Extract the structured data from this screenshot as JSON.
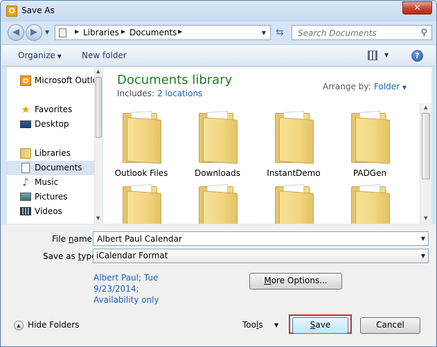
{
  "window": {
    "title": "Save As",
    "close_symbol": "✕"
  },
  "nav": {
    "breadcrumbs": [
      "Libraries",
      "Documents"
    ],
    "search_placeholder": "Search Documents"
  },
  "toolbar": {
    "organize": "Organize",
    "new_folder": "New folder"
  },
  "sidebar": {
    "items": [
      {
        "label": "Microsoft Outlo",
        "icon": "outlook-icon"
      },
      {
        "label": "Favorites",
        "icon": "star-icon"
      },
      {
        "label": "Desktop",
        "icon": "desktop-icon"
      },
      {
        "label": "Libraries",
        "icon": "library-icon"
      },
      {
        "label": "Documents",
        "icon": "document-icon",
        "selected": true
      },
      {
        "label": "Music",
        "icon": "music-icon"
      },
      {
        "label": "Pictures",
        "icon": "pictures-icon"
      },
      {
        "label": "Videos",
        "icon": "videos-icon"
      }
    ]
  },
  "library": {
    "title": "Documents library",
    "includes_label": "Includes:",
    "locations_link": "2 locations",
    "arrange_label": "Arrange by:",
    "arrange_value": "Folder"
  },
  "folders": [
    {
      "label": "Outlook Files"
    },
    {
      "label": "Downloads"
    },
    {
      "label": "InstantDemo"
    },
    {
      "label": "PADGen"
    },
    {
      "label": ""
    },
    {
      "label": ""
    },
    {
      "label": ""
    },
    {
      "label": ""
    }
  ],
  "form": {
    "file_name_label_pre": "File ",
    "file_name_label_u": "n",
    "file_name_label_post": "ame:",
    "file_name_value": "Albert Paul Calendar",
    "save_type_label_pre": "Save as ",
    "save_type_label_u": "t",
    "save_type_label_post": "ype:",
    "save_type_value": "iCalendar Format",
    "author_info": "Albert Paul; Tue 9/23/2014; Availability only",
    "more_options_pre": "",
    "more_options_u": "M",
    "more_options_post": "ore Options...",
    "hide_folders": "Hide Folders",
    "tools_pre": "Too",
    "tools_u": "l",
    "tools_post": "s",
    "save_pre": "",
    "save_u": "S",
    "save_post": "ave",
    "cancel": "Cancel"
  }
}
